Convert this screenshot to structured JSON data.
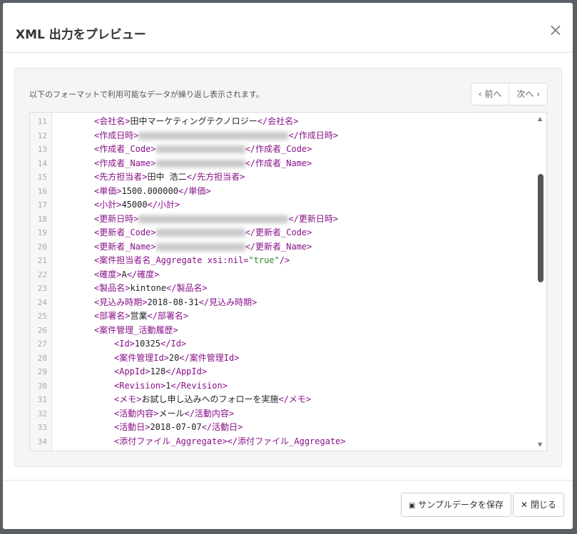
{
  "dialog": {
    "title": "XML 出力をプレビュー",
    "close_icon": "×"
  },
  "panel": {
    "description": "以下のフォーマットで利用可能なデータが繰り返し表示されます。",
    "prev_label": "‹ 前へ",
    "next_label": "次へ ›"
  },
  "lines": [
    {
      "n": "11",
      "i": 1,
      "t": "会社名",
      "v": "田中マーケティングテクノロジー"
    },
    {
      "n": "12",
      "i": 1,
      "t": "作成日時",
      "blur": 210
    },
    {
      "n": "13",
      "i": 1,
      "t": "作成者_Code",
      "blur": 125
    },
    {
      "n": "14",
      "i": 1,
      "t": "作成者_Name",
      "blur": 125
    },
    {
      "n": "15",
      "i": 1,
      "t": "先方担当者",
      "v": "田中 浩二"
    },
    {
      "n": "16",
      "i": 1,
      "t": "単価",
      "v": "1500.000000"
    },
    {
      "n": "17",
      "i": 1,
      "t": "小計",
      "v": "45000"
    },
    {
      "n": "18",
      "i": 1,
      "t": "更新日時",
      "blur": 210
    },
    {
      "n": "19",
      "i": 1,
      "t": "更新者_Code",
      "blur": 125
    },
    {
      "n": "20",
      "i": 1,
      "t": "更新者_Name",
      "blur": 125
    },
    {
      "n": "21",
      "i": 1,
      "raw": "<案件担当者名_Aggregate xsi:nil=",
      "str": "\"true\"",
      "end": "/>"
    },
    {
      "n": "22",
      "i": 1,
      "t": "確度",
      "v": "A"
    },
    {
      "n": "23",
      "i": 1,
      "t": "製品名",
      "v": "kintone"
    },
    {
      "n": "24",
      "i": 1,
      "t": "見込み時期",
      "v": "2018-08-31"
    },
    {
      "n": "25",
      "i": 1,
      "t": "部署名",
      "v": "営業"
    },
    {
      "n": "26",
      "i": 1,
      "raw": "<案件管理_活動履歴>"
    },
    {
      "n": "27",
      "i": 2,
      "t": "Id",
      "v": "10325"
    },
    {
      "n": "28",
      "i": 2,
      "t": "案件管理Id",
      "v": "20"
    },
    {
      "n": "29",
      "i": 2,
      "t": "AppId",
      "v": "128"
    },
    {
      "n": "30",
      "i": 2,
      "t": "Revision",
      "v": "1"
    },
    {
      "n": "31",
      "i": 2,
      "t": "メモ",
      "v": "お試し申し込みへのフォローを実施"
    },
    {
      "n": "32",
      "i": 2,
      "t": "活動内容",
      "v": "メール"
    },
    {
      "n": "33",
      "i": 2,
      "t": "活動日",
      "v": "2018-07-07"
    },
    {
      "n": "34",
      "i": 2,
      "t": "添付ファイル_Aggregate",
      "v": ""
    }
  ],
  "footer": {
    "save_label": "サンプルデータを保存",
    "close_label": "✕ 閉じる",
    "save_icon": "💾"
  }
}
